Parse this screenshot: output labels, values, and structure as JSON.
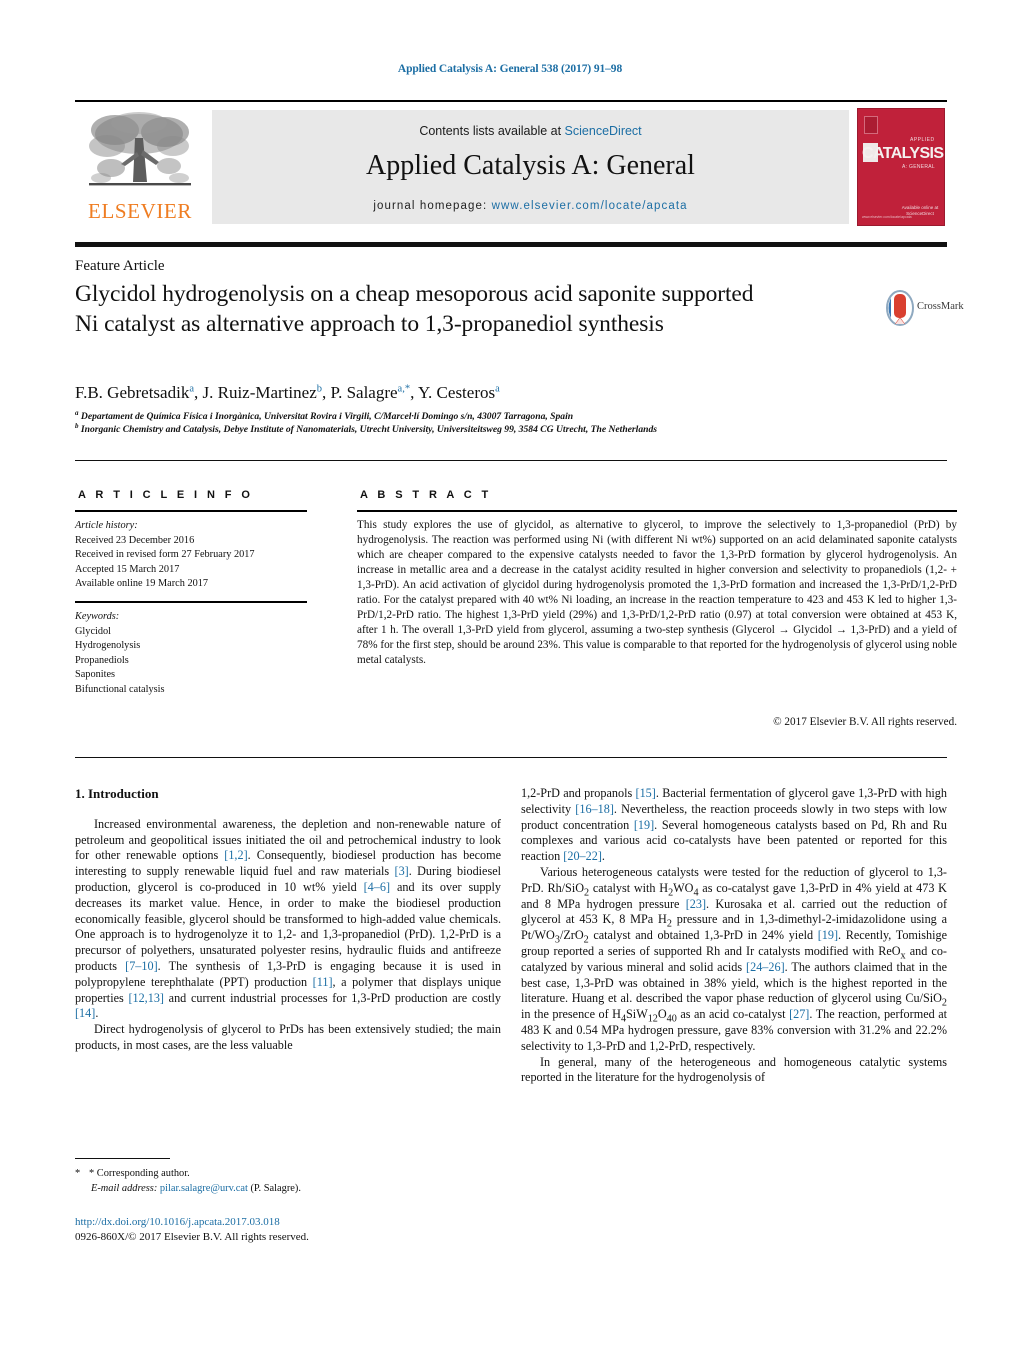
{
  "running_head": "Applied Catalysis A: General 538 (2017) 91–98",
  "masthead": {
    "contents_prefix": "Contents lists available at ",
    "sciencedirect": "ScienceDirect",
    "journal_title": "Applied Catalysis A: General",
    "homepage_prefix": "journal homepage: ",
    "homepage_url": "www.elsevier.com/locate/apcata",
    "publisher_wordmark": "ELSEVIER",
    "cover": {
      "title": "CATALYSIS",
      "kicker": "APPLIED",
      "subtitle": "A: GENERAL",
      "bottom": "Available online at ScienceDirect",
      "bottom_left": "www.elsevier.com/locate/apcata"
    },
    "accent_blue": "#1c6ea4",
    "elsevier_orange": "#ef7d22",
    "cover_red": "#c0213a"
  },
  "article": {
    "type": "Feature Article",
    "title": "Glycidol hydrogenolysis on a cheap mesoporous acid saponite supported Ni catalyst as alternative approach to 1,3-propanediol synthesis",
    "crossmark_label": "CrossMark",
    "authors": [
      {
        "name": "F.B. Gebretsadik",
        "marks": "a"
      },
      {
        "name": "J. Ruiz-Martinez",
        "marks": "b"
      },
      {
        "name": "P. Salagre",
        "marks": "a,*"
      },
      {
        "name": "Y. Cesteros",
        "marks": "a"
      }
    ],
    "affiliations": [
      {
        "mark": "a",
        "text": "Departament de Química Física i Inorgànica, Universitat Rovira i Virgili, C/Marcel·lí Domingo s/n, 43007 Tarragona, Spain"
      },
      {
        "mark": "b",
        "text": "Inorganic Chemistry and Catalysis, Debye Institute of Nanomaterials, Utrecht University, Universiteitsweg 99, 3584 CG Utrecht, The Netherlands"
      }
    ]
  },
  "article_info": {
    "label": "A R T I C L E   I N F O",
    "history_header": "Article history:",
    "history": [
      "Received 23 December 2016",
      "Received in revised form 27 February 2017",
      "Accepted 15 March 2017",
      "Available online 19 March 2017"
    ],
    "keywords_header": "Keywords:",
    "keywords": [
      "Glycidol",
      "Hydrogenolysis",
      "Propanediols",
      "Saponites",
      "Bifunctional catalysis"
    ]
  },
  "abstract": {
    "label": "A B S T R A C T",
    "text": "This study explores the use of glycidol, as alternative to glycerol, to improve the selectively to 1,3-propanediol (PrD) by hydrogenolysis. The reaction was performed using Ni (with different Ni wt%) supported on an acid delaminated saponite catalysts which are cheaper compared to the expensive catalysts needed to favor the 1,3-PrD formation by glycerol hydrogenolysis. An increase in metallic area and a decrease in the catalyst acidity resulted in higher conversion and selectivity to propanediols (1,2- + 1,3-PrD). An acid activation of glycidol during hydrogenolysis promoted the 1,3-PrD formation and increased the 1,3-PrD/1,2-PrD ratio. For the catalyst prepared with 40 wt% Ni loading, an increase in the reaction temperature to 423 and 453 K led to higher 1,3-PrD/1,2-PrD ratio. The highest 1,3-PrD yield (29%) and 1,3-PrD/1,2-PrD ratio (0.97) at total conversion were obtained at 453 K, after 1 h. The overall 1,3-PrD yield from glycerol, assuming a two-step synthesis (Glycerol → Glycidol → 1,3-PrD) and a yield of 78% for the first step, should be around 23%. This value is comparable to that reported for the hydrogenolysis of glycerol using noble metal catalysts.",
    "copyright": "© 2017 Elsevier B.V. All rights reserved."
  },
  "body": {
    "section_number_title": "1.  Introduction",
    "left_paragraph_1_parts": [
      "Increased environmental awareness, the depletion and non-renewable nature of petroleum and geopolitical issues initiated the oil and petrochemical industry to look for other renewable options ",
      "[1,2]",
      ". Consequently, biodiesel production has become interesting to supply renewable liquid fuel and raw materials ",
      "[3]",
      ". During biodiesel production, glycerol is co-produced in 10 wt% yield ",
      "[4–6]",
      " and its over supply decreases its market value. Hence, in order to make the biodiesel production economically feasible, glycerol should be transformed to high-added value chemicals. One approach is to hydrogenolyze it to 1,2- and 1,3-propanediol (PrD). 1,2-PrD is a precursor of polyethers, unsaturated polyester resins, hydraulic fluids and antifreeze products ",
      "[7–10]",
      ". The synthesis of 1,3-PrD is engaging because it is used in polypropylene terephthalate (PPT) production ",
      "[11]",
      ", a polymer that displays unique properties ",
      "[12,13]",
      " and current industrial processes for 1,3-PrD production are costly ",
      "[14]",
      "."
    ],
    "left_paragraph_2": "Direct hydrogenolysis of glycerol to PrDs has been extensively studied; the main products, in most cases, are the less valuable",
    "right_paragraph_1_parts": [
      "1,2-PrD and propanols ",
      "[15]",
      ". Bacterial fermentation of glycerol gave 1,3-PrD with high selectivity ",
      "[16–18]",
      ". Nevertheless, the reaction proceeds slowly in two steps with low product concentration ",
      "[19]",
      ". Several homogeneous catalysts based on Pd, Rh and Ru complexes and various acid co-catalysts have been patented or reported for this reaction ",
      "[20–22]",
      "."
    ],
    "right_paragraph_3": "In general, many of the heterogeneous and homogeneous catalytic systems reported in the literature for the hydrogenolysis of"
  },
  "footer": {
    "corresponding_author": "* Corresponding author.",
    "email_label": "E-mail address:",
    "email": "pilar.salagre@urv.cat",
    "email_suffix": "(P. Salagre).",
    "doi": "http://dx.doi.org/10.1016/j.apcata.2017.03.018",
    "issn_line": "0926-860X/© 2017 Elsevier B.V. All rights reserved."
  }
}
